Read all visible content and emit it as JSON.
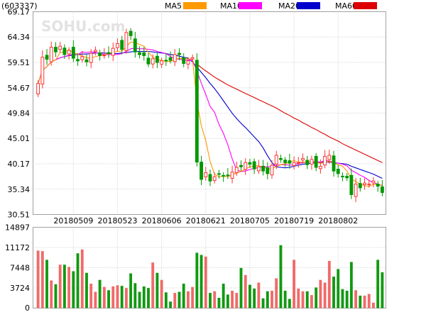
{
  "chart_data": [
    {
      "type": "candlestick",
      "code_label": "(603337)",
      "ylim": [
        30.51,
        69.17
      ],
      "y_ticks": [
        30.51,
        35.34,
        40.17,
        45.01,
        49.84,
        54.67,
        59.51,
        64.34,
        69.17
      ],
      "y_tick_labels": [
        "30.51",
        "35.34",
        "40.17",
        "45.01",
        "49.84",
        "54.67",
        "59.51",
        "64.34",
        "69.17"
      ],
      "x_tick_labels": [
        {
          "index": 8,
          "label": "20180509"
        },
        {
          "index": 18,
          "label": "20180523"
        },
        {
          "index": 28,
          "label": "20180606"
        },
        {
          "index": 38,
          "label": "20180621"
        },
        {
          "index": 48,
          "label": "20180705"
        },
        {
          "index": 58,
          "label": "20180719"
        },
        {
          "index": 68,
          "label": "20180802"
        }
      ],
      "legend": {
        "placement": "top-right",
        "items": [
          {
            "name": "MA5",
            "color": "#ff9900"
          },
          {
            "name": "MA10",
            "color": "#ff00ff"
          },
          {
            "name": "MA20",
            "color": "#0000cc"
          },
          {
            "name": "MA60",
            "color": "#dd0000"
          }
        ]
      },
      "up_color": "#ff3333",
      "down_color": "#009900",
      "grid": true,
      "close": [
        55.5,
        60.5,
        60.1,
        62.4,
        61.5,
        62.6,
        61.0,
        61.8,
        60.3,
        59.8,
        60.6,
        59.6,
        61.2,
        61.8,
        60.8,
        60.9,
        61.2,
        62.2,
        63.1,
        62.0,
        65.2,
        64.6,
        61.5,
        61.0,
        60.8,
        59.2,
        60.2,
        59.5,
        59.8,
        59.8,
        59.9,
        61.0,
        61.0,
        59.3,
        59.8,
        60.4,
        40.5,
        37.2,
        38.5,
        36.9,
        37.7,
        38.2,
        37.8,
        38.0,
        38.6,
        39.5,
        39.6,
        40.4,
        40.1,
        39.2,
        39.6,
        38.8,
        38.3,
        39.9,
        41.8,
        41.0,
        40.4,
        40.3,
        40.4,
        40.4,
        41.2,
        40.0,
        41.0,
        39.5,
        39.7,
        41.6,
        41.8,
        38.8,
        38.3,
        37.8,
        37.5,
        34.3,
        36.3,
        35.6,
        36.5,
        36.3,
        36.9,
        35.9,
        34.7
      ],
      "ma5": [
        55.5,
        58.0,
        58.7,
        59.6,
        60.0,
        61.4,
        61.5,
        61.9,
        61.4,
        61.1,
        60.7,
        60.4,
        60.3,
        60.6,
        60.8,
        60.9,
        61.2,
        61.4,
        61.6,
        61.7,
        62.5,
        63.4,
        63.3,
        62.9,
        62.6,
        61.4,
        60.5,
        60.1,
        59.9,
        59.7,
        59.7,
        60.0,
        60.3,
        60.2,
        60.2,
        60.1,
        52.0,
        47.4,
        44.6,
        40.6,
        38.2,
        37.7,
        37.8,
        37.7,
        38.1,
        38.4,
        38.7,
        39.2,
        39.6,
        39.8,
        39.8,
        39.6,
        39.2,
        39.2,
        39.7,
        40.0,
        40.2,
        40.5,
        40.8,
        40.5,
        40.5,
        40.5,
        40.6,
        40.4,
        40.3,
        40.4,
        40.7,
        40.3,
        40.0,
        39.7,
        38.8,
        37.3,
        36.8,
        36.3,
        36.0,
        35.8,
        36.3,
        36.2,
        36.1
      ],
      "ma10": [
        55.5,
        58.0,
        58.7,
        59.6,
        60.0,
        60.4,
        60.6,
        60.9,
        61.0,
        61.0,
        61.5,
        61.4,
        61.5,
        61.4,
        61.2,
        61.0,
        61.0,
        61.0,
        61.0,
        61.2,
        61.6,
        62.1,
        62.2,
        62.1,
        62.1,
        62.0,
        61.9,
        61.6,
        61.4,
        61.2,
        60.6,
        60.3,
        60.1,
        60.0,
        59.9,
        59.9,
        57.9,
        55.5,
        53.4,
        51.1,
        50.0,
        47.7,
        46.0,
        43.8,
        41.1,
        39.0,
        38.7,
        38.8,
        39.1,
        39.3,
        39.5,
        39.6,
        39.6,
        39.7,
        39.9,
        40.0,
        40.0,
        39.9,
        40.0,
        40.2,
        40.4,
        40.5,
        40.6,
        40.6,
        40.5,
        40.8,
        40.7,
        40.5,
        40.3,
        40.1,
        39.8,
        38.9,
        38.5,
        38.0,
        37.6,
        37.0,
        36.6,
        36.3,
        36.0
      ],
      "ma20": [
        55.5,
        58.0,
        58.7,
        59.6,
        60.0,
        60.4,
        60.6,
        60.8,
        60.9,
        61.0,
        61.1,
        61.1,
        61.2,
        61.3,
        61.3,
        61.3,
        61.2,
        61.2,
        61.2,
        61.3,
        61.4,
        61.5,
        61.6,
        61.6,
        61.6,
        61.6,
        61.5,
        61.4,
        61.3,
        61.2,
        61.0,
        60.9,
        60.7,
        60.5,
        60.3,
        59.6,
        58.6,
        57.6,
        56.6,
        55.5,
        54.5,
        53.4,
        52.2,
        51.0,
        49.8,
        48.8,
        47.9,
        47.1,
        46.2,
        45.3,
        44.4,
        43.2,
        41.7,
        40.4,
        39.6,
        39.5,
        39.4,
        39.5,
        39.7,
        39.9,
        40.1,
        40.2,
        40.3,
        40.4,
        40.4,
        40.5,
        40.5,
        40.4,
        40.3,
        40.2,
        40.1,
        39.7,
        39.4,
        39.1,
        38.8,
        38.5,
        38.2,
        37.8,
        37.4
      ],
      "ma60": [
        null,
        null,
        null,
        null,
        null,
        null,
        null,
        null,
        null,
        null,
        null,
        null,
        null,
        null,
        null,
        null,
        null,
        null,
        null,
        null,
        null,
        null,
        null,
        null,
        null,
        null,
        null,
        null,
        null,
        null,
        null,
        null,
        null,
        null,
        null,
        null,
        59.2,
        58.5,
        57.9,
        57.3,
        56.7,
        56.2,
        55.7,
        55.2,
        54.8,
        54.4,
        54.0,
        53.6,
        53.2,
        52.8,
        52.4,
        52.0,
        51.6,
        51.2,
        50.8,
        50.3,
        49.8,
        49.4,
        48.9,
        48.5,
        48.0,
        47.6,
        47.1,
        46.7,
        46.2,
        45.8,
        45.3,
        44.9,
        44.5,
        44.0,
        43.6,
        43.2,
        42.8,
        42.4,
        42.0,
        41.6,
        41.2,
        40.8,
        40.4
      ]
    },
    {
      "type": "bar",
      "ylim": [
        0,
        14897
      ],
      "y_ticks": [
        0,
        3724,
        7448,
        11172,
        14897
      ],
      "y_tick_labels": [
        "0",
        "3724",
        "7448",
        "11172",
        "14897"
      ],
      "grid": true,
      "volume": [
        10600,
        10500,
        8900,
        5100,
        4400,
        8000,
        8000,
        7600,
        6800,
        10100,
        10800,
        6500,
        4500,
        3000,
        5200,
        3900,
        3300,
        4000,
        4200,
        4100,
        3700,
        6400,
        4600,
        3000,
        4000,
        3700,
        8400,
        6500,
        5200,
        2900,
        1200,
        2800,
        3000,
        4500,
        3100,
        3900,
        10200,
        9800,
        9500,
        2800,
        3100,
        1900,
        4500,
        2500,
        3200,
        2800,
        7400,
        6100,
        4300,
        3600,
        4700,
        1800,
        3100,
        3200,
        5500,
        11600,
        3200,
        1700,
        8900,
        3600,
        3100,
        3100,
        2400,
        3800,
        5200,
        4700,
        8700,
        5800,
        7200,
        3500,
        3200,
        8500,
        3300,
        2300,
        2300,
        2600,
        1000,
        8900,
        6600
      ]
    }
  ]
}
